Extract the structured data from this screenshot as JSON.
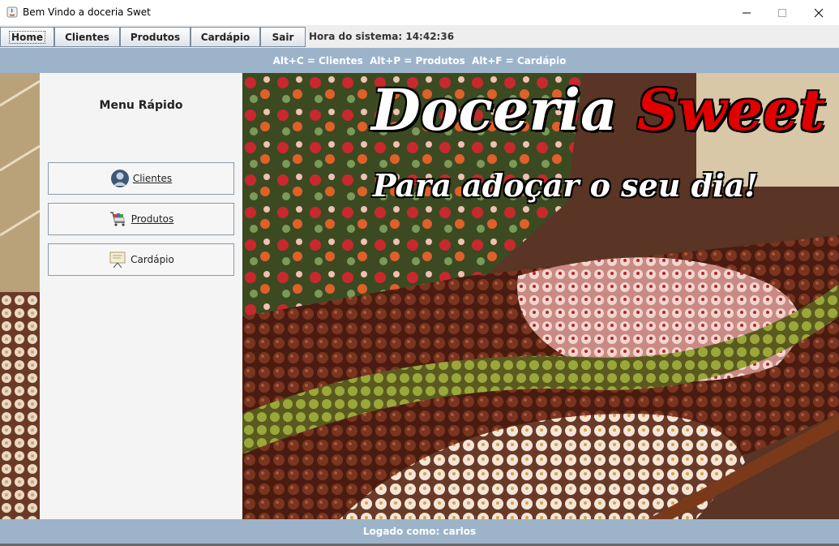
{
  "window": {
    "title": "Bem Vindo a doceria Swet",
    "controls": [
      "minimize-icon",
      "maximize-icon",
      "close-icon"
    ]
  },
  "toolbar": {
    "buttons": [
      {
        "label": "Home"
      },
      {
        "label": "Clientes"
      },
      {
        "label": "Produtos"
      },
      {
        "label": "Cardápio"
      },
      {
        "label": "Sair"
      }
    ],
    "clock_label": "Hora do sistema:",
    "clock_value": "14:42:36"
  },
  "shortcuts": {
    "text": "Alt+C = Clientes  Alt+P = Produtos  Alt+F = Cardápio"
  },
  "quick_menu": {
    "title": "Menu Rápido",
    "items": [
      {
        "label": "Clientes",
        "icon": "user-avatar-icon"
      },
      {
        "label": "Produtos",
        "icon": "shopping-cart-icon"
      },
      {
        "label": "Cardápio",
        "icon": "menu-board-icon"
      }
    ]
  },
  "hero": {
    "brand_part1": "Doceria",
    "brand_part2": "Sweet",
    "tagline": "Para adoçar o seu dia!"
  },
  "status": {
    "logged_in_text": "Logado como: carlos"
  },
  "colors": {
    "banner_bg": "#9db3ca",
    "accent_red": "#e00000"
  }
}
